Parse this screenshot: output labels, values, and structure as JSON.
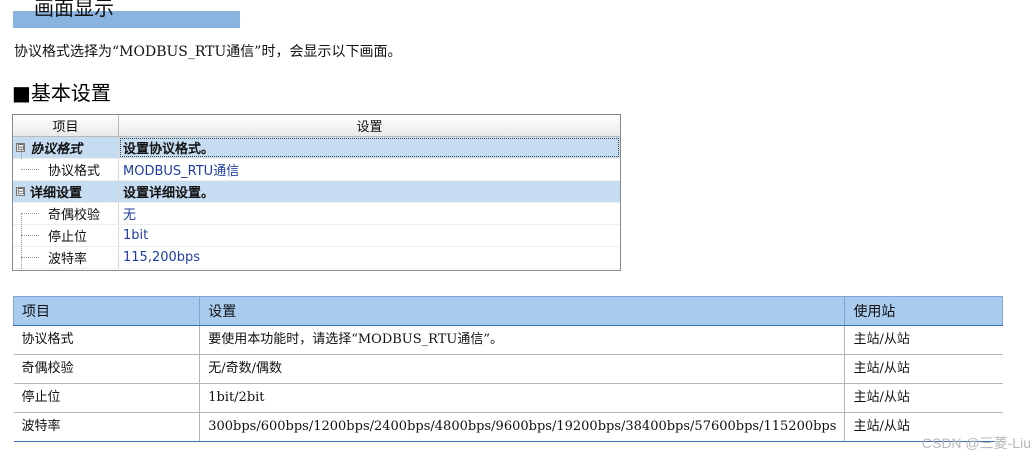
{
  "heading": {
    "title": "画面显示",
    "banner_color": "#8ab4e0"
  },
  "intro_text": "协议格式选择为“MODBUS_RTU通信”时，会显示以下画面。",
  "section_title": "■基本设置",
  "property_grid": {
    "col_item": "项目",
    "col_setting": "设置",
    "rows": [
      {
        "type": "category",
        "key": "协议格式",
        "value": "设置协议格式。",
        "toggle": "⊟"
      },
      {
        "type": "child",
        "key": "协议格式",
        "value": "MODBUS_RTU通信"
      },
      {
        "type": "category",
        "key": "详细设置",
        "value": "设置详细设置。",
        "toggle": "⊟"
      },
      {
        "type": "child",
        "key": "奇偶校验",
        "value": "无"
      },
      {
        "type": "child",
        "key": "停止位",
        "value": "1bit"
      },
      {
        "type": "child",
        "key": "波特率",
        "value": "115,200bps"
      }
    ]
  },
  "table": {
    "headers": [
      "项目",
      "设置",
      "使用站"
    ],
    "rows": [
      [
        "协议格式",
        "要使用本功能时，请选择“MODBUS_RTU通信”。",
        "主站/从站"
      ],
      [
        "奇偶校验",
        "无/奇数/偶数",
        "主站/从站"
      ],
      [
        "停止位",
        "1bit/2bit",
        "主站/从站"
      ],
      [
        "波特率",
        "300bps/600bps/1200bps/2400bps/4800bps/9600bps/19200bps/38400bps/57600bps/115200bps",
        "主站/从站"
      ]
    ],
    "header_color": "#a9cbee"
  },
  "watermark": "CSDN @三菱-Liu"
}
